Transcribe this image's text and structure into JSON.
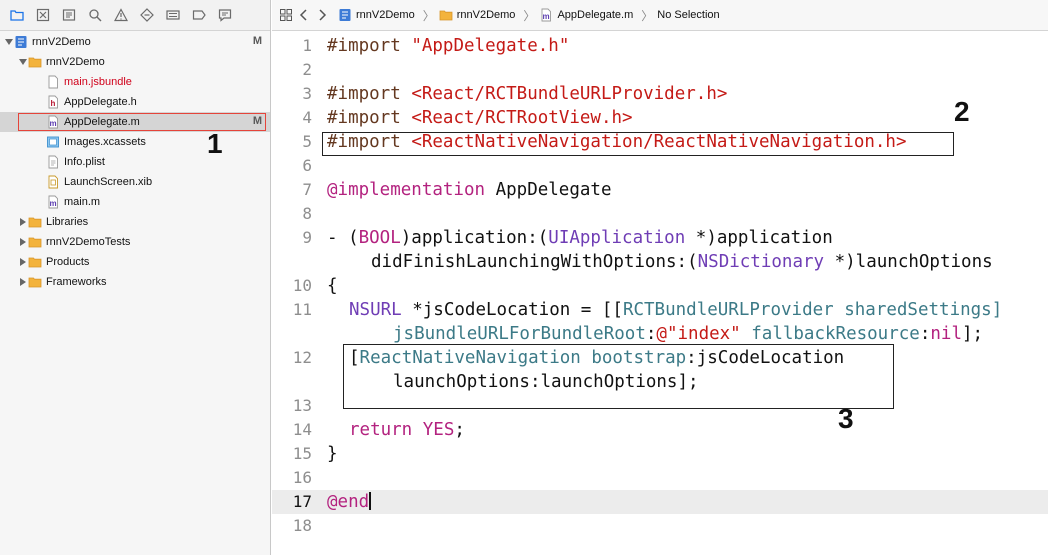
{
  "navigator": {
    "toolbar_icons": [
      "folder-icon",
      "source-control-icon",
      "symbol-icon",
      "search-icon",
      "warning-icon",
      "test-icon",
      "debug-icon",
      "breakpoint-icon",
      "report-icon"
    ],
    "items": [
      {
        "label": "rnnV2Demo",
        "icon": "project-icon",
        "badge": "M"
      },
      {
        "label": "rnnV2Demo",
        "icon": "folder-icon",
        "badge": ""
      },
      {
        "label": "main.jsbundle",
        "icon": "file-icon",
        "badge": ""
      },
      {
        "label": "AppDelegate.h",
        "icon": "header-file-icon",
        "badge": ""
      },
      {
        "label": "AppDelegate.m",
        "icon": "objc-file-icon",
        "badge": "M"
      },
      {
        "label": "Images.xcassets",
        "icon": "assets-icon",
        "badge": ""
      },
      {
        "label": "Info.plist",
        "icon": "plist-icon",
        "badge": ""
      },
      {
        "label": "LaunchScreen.xib",
        "icon": "xib-icon",
        "badge": ""
      },
      {
        "label": "main.m",
        "icon": "objc-file-icon",
        "badge": ""
      },
      {
        "label": "Libraries",
        "icon": "folder-icon",
        "badge": ""
      },
      {
        "label": "rnnV2DemoTests",
        "icon": "folder-icon",
        "badge": ""
      },
      {
        "label": "Products",
        "icon": "folder-icon",
        "badge": ""
      },
      {
        "label": "Frameworks",
        "icon": "folder-icon",
        "badge": ""
      }
    ]
  },
  "jumpbar": {
    "crumbs": [
      "rnnV2Demo",
      "rnnV2Demo",
      "AppDelegate.m",
      "No Selection"
    ]
  },
  "code": {
    "line_numbers": [
      "1",
      "2",
      "3",
      "4",
      "5",
      "6",
      "7",
      "8",
      "9",
      "10",
      "11",
      "12",
      "13",
      "14",
      "15",
      "16",
      "17",
      "18"
    ],
    "line1": {
      "kw": "#import",
      "str": "\"AppDelegate.h\""
    },
    "line3": {
      "kw": "#import",
      "str": "<React/RCTBundleURLProvider.h>"
    },
    "line4": {
      "kw": "#import",
      "str": "<React/RCTRootView.h>"
    },
    "line5": {
      "kw": "#import",
      "str": "<ReactNativeNavigation/ReactNativeNavigation.h>"
    },
    "line7": {
      "kw": "@implementation",
      "name": "AppDelegate"
    },
    "line9a": {
      "dash": "- (",
      "bool": "BOOL",
      "rest1": ")application:(",
      "uiapp": "UIApplication",
      "rest2": " *)application"
    },
    "line9b": {
      "rest1": "didFinishLaunchingWithOptions:(",
      "nsdict": "NSDictionary",
      "rest2": " *)launchOptions"
    },
    "line10": {
      "text": "{"
    },
    "line11a": {
      "nsurl": "NSURL",
      "rest1": " *jsCodeLocation = [[",
      "provider": "RCTBundleURLProvider",
      "rest2": " sharedSettings]"
    },
    "line11b": {
      "m1": "jsBundleURLForBundleRoot",
      "colon1": ":",
      "str": "@\"index\"",
      "m2": " fallbackResource",
      "colon2": ":",
      "nil": "nil",
      "end": "];"
    },
    "line12a": {
      "open": "[",
      "rnn": "ReactNativeNavigation",
      "m1": " bootstrap",
      "rest": ":jsCodeLocation"
    },
    "line12b": {
      "text": "launchOptions:launchOptions];"
    },
    "line14": {
      "kw": "return",
      "yes": "YES",
      "end": ";"
    },
    "line16": {
      "text": "}"
    },
    "line17": {
      "kw": "@end"
    }
  },
  "callouts": {
    "one": "1",
    "two": "2",
    "three": "3"
  }
}
